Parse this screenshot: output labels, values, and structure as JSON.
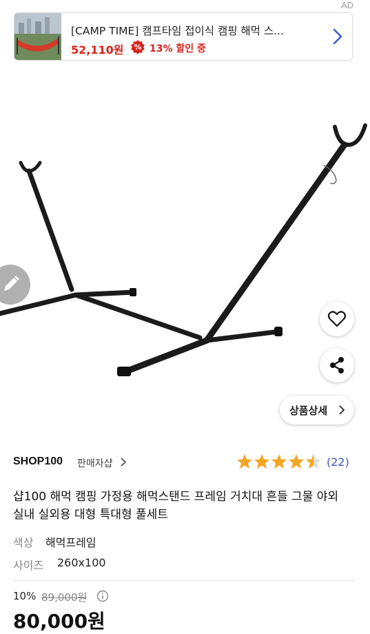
{
  "ad": {
    "tag": "AD",
    "title": "[CAMP TIME] 캠프타임 접이식 캠핑 해먹 스...",
    "price": "52,110원",
    "discount": "13% 할인 중"
  },
  "detail_button": {
    "label": "상품상세"
  },
  "shop": {
    "name": "SHOP100",
    "link": "판매자샵",
    "rating": 4.5,
    "review_count": "(22)"
  },
  "product": {
    "title": "샵100 해먹 캠핑 가정용 해먹스탠드 프레임 거치대 흔들 그물 야외 실내 실외용 대형 특대형 풀세트",
    "options": [
      {
        "label": "색상",
        "value": "해먹프레임"
      },
      {
        "label": "사이즈",
        "value": "260x100"
      }
    ],
    "discount_rate": "10%",
    "original_price": "89,000원",
    "sale_price": "80,000원"
  },
  "colors": {
    "price_red": "#d6231b",
    "star": "#f5a623",
    "link_blue": "#3a57c4"
  }
}
